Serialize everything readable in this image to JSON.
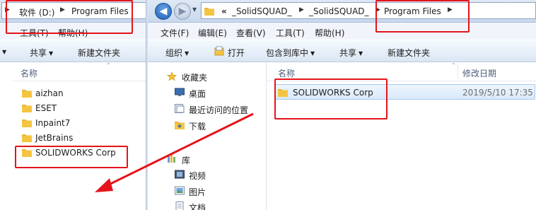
{
  "left_window": {
    "address_path": [
      "软件 (D:)",
      "Program Files"
    ],
    "menu": [
      "工具(T)",
      "帮助(H)"
    ],
    "toolbar": [
      "共享",
      "新建文件夹"
    ],
    "column_header": "名称",
    "items": [
      "aizhan",
      "ESET",
      "Inpaint7",
      "JetBrains",
      "SOLIDWORKS Corp"
    ]
  },
  "right_window": {
    "address_path": [
      "«",
      "_SolidSQUAD_",
      "_SolidSQUAD_",
      "Program Files"
    ],
    "menu": [
      "文件(F)",
      "编辑(E)",
      "查看(V)",
      "工具(T)",
      "帮助(H)"
    ],
    "toolbar": [
      "组织",
      "打开",
      "包含到库中",
      "共享",
      "新建文件夹"
    ],
    "nav_pane": {
      "favorites_label": "收藏夹",
      "favorites": [
        "桌面",
        "最近访问的位置",
        "下载"
      ],
      "libraries_label": "库",
      "libraries": [
        "视频",
        "图片",
        "文档"
      ]
    },
    "columns": [
      "名称",
      "修改日期"
    ],
    "row": {
      "name": "SOLIDWORKS Corp",
      "date": "2019/5/10 17:35"
    }
  },
  "colors": {
    "annotation_red": "#e5131a",
    "folder_yellow": "#f5c542",
    "selection_blue": "#d9e9fb"
  }
}
